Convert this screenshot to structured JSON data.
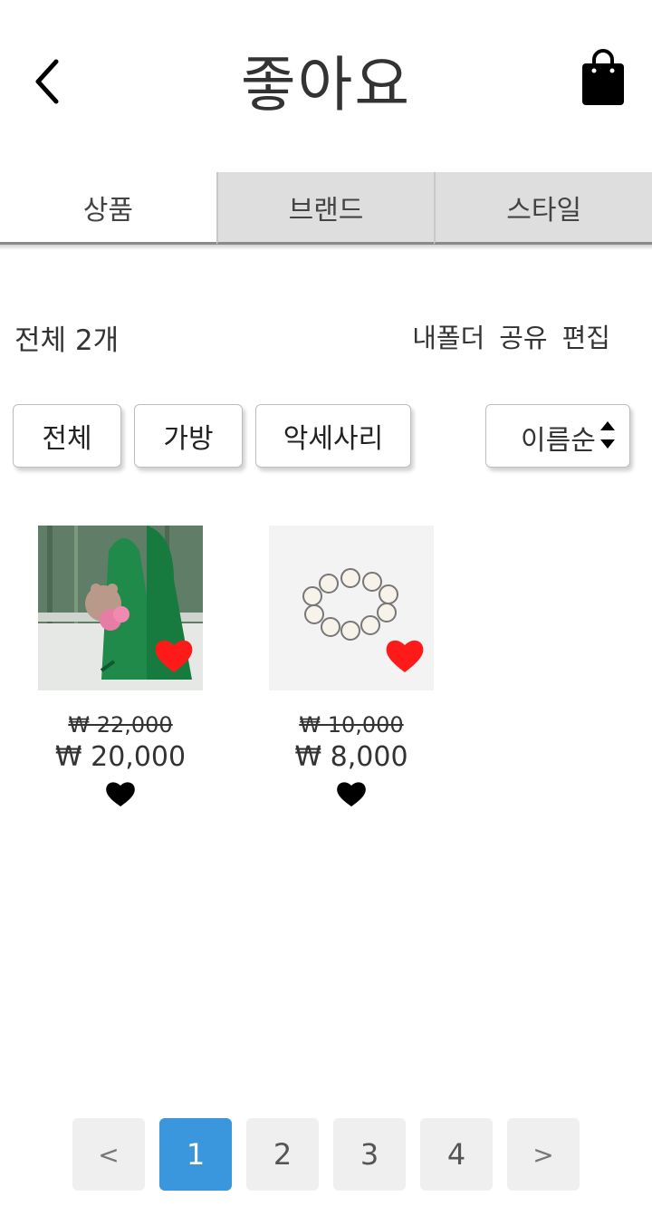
{
  "header": {
    "title": "좋아요"
  },
  "tabs": [
    {
      "label": "상품",
      "active": true
    },
    {
      "label": "브랜드",
      "active": false
    },
    {
      "label": "스타일",
      "active": false
    }
  ],
  "summary": {
    "count_label": "전체 2개"
  },
  "actions": {
    "folder": "내폴더",
    "share": "공유",
    "edit": "편집"
  },
  "filters": [
    {
      "label": "전체"
    },
    {
      "label": "가방"
    },
    {
      "label": "악세사리"
    }
  ],
  "sort": {
    "selected": "이름순"
  },
  "products": [
    {
      "name": "green knit bag with bear charm",
      "original_price": "₩ 22,000",
      "price": "₩ 20,000",
      "liked": true
    },
    {
      "name": "pearl bracelet",
      "original_price": "₩ 10,000",
      "price": "₩ 8,000",
      "liked": true
    }
  ],
  "pagination": {
    "prev": "<",
    "pages": [
      "1",
      "2",
      "3",
      "4"
    ],
    "current": "1",
    "next": ">"
  },
  "colors": {
    "accent": "#3a96dd",
    "heart": "#ff1a1a",
    "tab_inactive": "#dedede"
  }
}
